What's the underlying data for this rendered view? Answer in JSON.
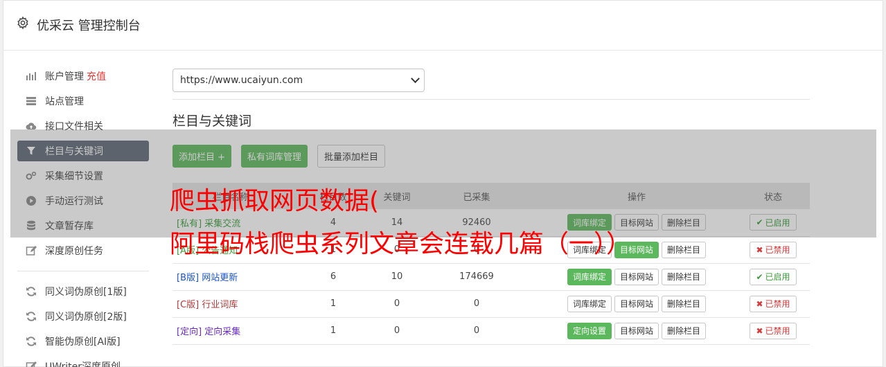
{
  "app_title": "优采云 管理控制台",
  "sidebar": {
    "items": [
      {
        "label": "账户管理",
        "extra": "充值",
        "icon": "bar-chart-icon"
      },
      {
        "label": "站点管理",
        "icon": "server-icon"
      },
      {
        "label": "接口文件相关",
        "icon": "cloud-upload-icon"
      },
      {
        "label": "栏目与关键词",
        "icon": "filter-icon"
      },
      {
        "label": "采集细节设置",
        "icon": "gears-icon"
      },
      {
        "label": "手动运行测试",
        "icon": "play-circle-icon"
      },
      {
        "label": "文章暂存库",
        "icon": "database-icon"
      },
      {
        "label": "深度原创任务",
        "icon": "edit-icon"
      }
    ],
    "items2": [
      {
        "label": "同义词伪原创[1版]",
        "icon": "refresh-icon"
      },
      {
        "label": "同义词伪原创[2版]",
        "icon": "refresh-icon"
      },
      {
        "label": "智能伪原创[AI版]",
        "icon": "refresh-icon"
      },
      {
        "label": "UWriter深度原创",
        "icon": "edit-icon"
      }
    ]
  },
  "main": {
    "site_select": "https://www.ucaiyun.com",
    "section_title": "栏目与关键词",
    "buttons": {
      "add_column": "添加栏目 +",
      "private_lib": "私有词库管理",
      "batch_add": "批量添加栏目"
    },
    "table": {
      "headers": [
        "栏目名称",
        "栏目数",
        "关键词",
        "已采集",
        "操作",
        "状态"
      ],
      "rows": [
        {
          "tag": "[私有]",
          "name": "采集交流",
          "a": "4",
          "b": "14",
          "c": "92460",
          "op1": "词库绑定",
          "op2": "目标网站",
          "op3": "删除栏目",
          "status": "已启用"
        },
        {
          "tag": "[A版]",
          "name": "公告通知",
          "a": "1",
          "b": "0",
          "c": "0",
          "op1": "词库绑定",
          "op2": "目标网站",
          "op3": "删除栏目",
          "status": "已禁用"
        },
        {
          "tag": "[B版]",
          "name": "网站更新",
          "a": "6",
          "b": "10",
          "c": "174669",
          "op1": "词库绑定",
          "op2": "目标网站",
          "op3": "删除栏目",
          "status": "已启用"
        },
        {
          "tag": "[C版]",
          "name": "行业词库",
          "a": "1",
          "b": "0",
          "c": "0",
          "op1": "词库绑定",
          "op2": "目标网站",
          "op3": "删除栏目",
          "status": "已禁用"
        },
        {
          "tag": "[定向]",
          "name": "定向采集",
          "a": "1",
          "b": "0",
          "c": "0",
          "op1": "定向设置",
          "op2": "目标网站",
          "op3": "删除栏目",
          "status": "已禁用"
        }
      ]
    }
  },
  "overlay": {
    "line1": "爬虫抓取网页数据(",
    "line2": "阿里码栈爬虫系列文章会连载几篇（一））"
  }
}
